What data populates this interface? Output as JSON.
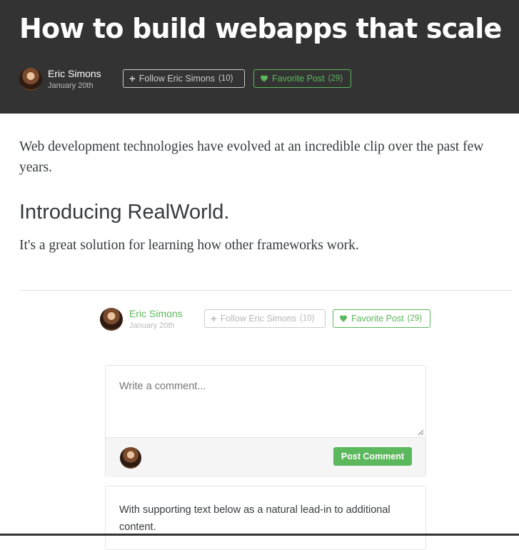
{
  "article": {
    "title": "How to build webapps that scale",
    "author": {
      "name": "Eric Simons",
      "date": "January 20th",
      "avatar_icon": "user-avatar"
    },
    "follow_button": {
      "label": "Follow Eric Simons",
      "count": "(10)",
      "icon": "plus-icon"
    },
    "favorite_button": {
      "label": "Favorite Post",
      "count": "(29)",
      "icon": "heart-icon"
    },
    "body": {
      "intro": "Web development technologies have evolved at an incredible clip over the past few years.",
      "heading": "Introducing RealWorld.",
      "paragraph": "It's a great solution for learning how other frameworks work."
    }
  },
  "comment_form": {
    "placeholder": "Write a comment...",
    "submit_label": "Post Comment"
  },
  "comments": [
    {
      "text": "With supporting text below as a natural lead-in to additional content."
    }
  ],
  "colors": {
    "banner": "#333333",
    "accent": "#5cb85c",
    "text": "#373a3c"
  }
}
